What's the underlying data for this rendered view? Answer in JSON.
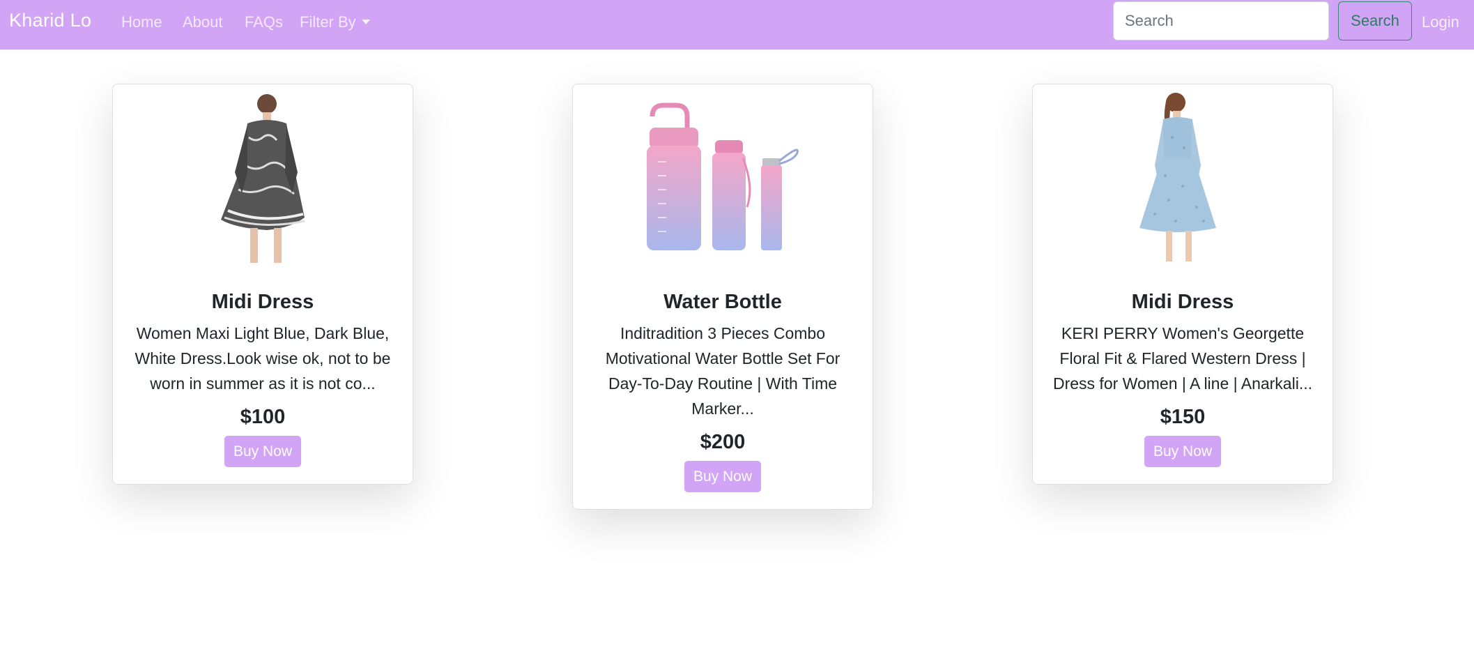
{
  "navbar": {
    "brand": "Kharid Lo",
    "links": [
      "Home",
      "About",
      "FAQs"
    ],
    "filter_label": "Filter By",
    "search_placeholder": "Search",
    "search_button": "Search",
    "login": "Login"
  },
  "products": [
    {
      "title": "Midi Dress",
      "description": "Women Maxi Light Blue, Dark Blue, White Dress.Look wise ok, not to be worn in summer as it is not co...",
      "price": "$100",
      "button": "Buy Now",
      "image": "black-white-print-dress"
    },
    {
      "title": "Water Bottle",
      "description": "Inditradition 3 Pieces Combo Motivational Water Bottle Set For Day-To-Day Routine | With Time Marker...",
      "price": "$200",
      "button": "Buy Now",
      "image": "pink-blue-water-bottle-set"
    },
    {
      "title": "Midi Dress",
      "description": "KERI PERRY Women's Georgette Floral Fit & Flared Western Dress | Dress for Women | A line | Anarkali...",
      "price": "$150",
      "button": "Buy Now",
      "image": "light-blue-floral-dress"
    }
  ],
  "colors": {
    "navbar_bg": "#d1a4f5",
    "button_bg": "#d1a4f5",
    "search_button_border": "#3a8a75"
  }
}
